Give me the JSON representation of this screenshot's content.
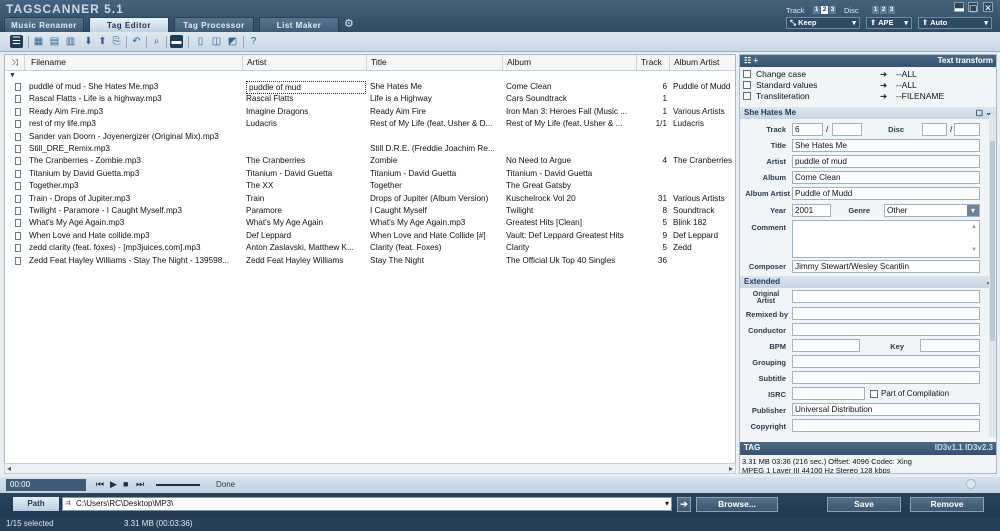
{
  "app": {
    "title": "TAGSCANNER 5.1"
  },
  "tabs": [
    "Music Renamer",
    "Tag Editor",
    "Tag Processor",
    "List Maker"
  ],
  "topright": {
    "track_label": "Track",
    "disc_label": "Disc",
    "keep": "Keep",
    "ape": "APE",
    "auto": "Auto"
  },
  "columns": {
    "filename": "Filename",
    "artist": "Artist",
    "title": "Title",
    "album": "Album",
    "track": "Track",
    "album_artist": "Album Artist"
  },
  "rows": [
    {
      "filename": "puddle of mud - She Hates Me.mp3",
      "artist": "puddle of mud",
      "title": "She Hates Me",
      "album": "Come Clean",
      "track": "6",
      "album_artist": "Puddle of Mudd"
    },
    {
      "filename": "Rascal Flatts - Life is a highway.mp3",
      "artist": "Rascal Flatts",
      "title": "Life is a Highway",
      "album": "Cars Soundtrack",
      "track": "1",
      "album_artist": ""
    },
    {
      "filename": "Ready Aim Fire.mp3",
      "artist": "Imagine Dragons",
      "title": "Ready Aim Fire",
      "album": "Iron Man 3: Heroes Fall (Music ...",
      "track": "1",
      "album_artist": "Various Artists"
    },
    {
      "filename": "rest of my life.mp3",
      "artist": "Ludacris",
      "title": "Rest of My Life (feat. Usher & D...",
      "album": "Rest of My Life (feat. Usher & ...",
      "track": "1/1",
      "album_artist": "Ludacris"
    },
    {
      "filename": "Sander van Doorn - Joyenergizer (Original Mix).mp3",
      "artist": "",
      "title": "",
      "album": "",
      "track": "",
      "album_artist": ""
    },
    {
      "filename": "Still_DRE_Remix.mp3",
      "artist": "",
      "title": "Still D.R.E. (Freddie Joachim Re...",
      "album": "",
      "track": "",
      "album_artist": ""
    },
    {
      "filename": "The Cranberries - Zombie.mp3",
      "artist": "The Cranberries",
      "title": "Zombie",
      "album": "No Need to Argue",
      "track": "4",
      "album_artist": "The Cranberries"
    },
    {
      "filename": "Titanium by David Guetta.mp3",
      "artist": "Titanium - David Guetta",
      "title": "Titanium - David Guetta",
      "album": "Titanium - David Guetta",
      "track": "",
      "album_artist": ""
    },
    {
      "filename": "Together.mp3",
      "artist": "The XX",
      "title": "Together",
      "album": "The Great Gatsby",
      "track": "",
      "album_artist": ""
    },
    {
      "filename": "Train - Drops of Jupiter.mp3",
      "artist": "Train",
      "title": "Drops of Jupiter (Album Version)",
      "album": "Kuschelrock Vol 20",
      "track": "31",
      "album_artist": "Various Artists"
    },
    {
      "filename": "Twilight - Paramore - I Caught Myself.mp3",
      "artist": "Paramore",
      "title": "I Caught Myself",
      "album": "Twilight",
      "track": "8",
      "album_artist": "Soundtrack"
    },
    {
      "filename": "What's My Age Again.mp3",
      "artist": "What's My Age Again",
      "title": "What's My Age Again.mp3",
      "album": "Greatest Hits [Clean]",
      "track": "5",
      "album_artist": "Blink 182"
    },
    {
      "filename": "When Love and Hate collide.mp3",
      "artist": "Def Leppard",
      "title": "When Love and Hate Collide [#]",
      "album": "Vault: Def Leppard Greatest Hits",
      "track": "9",
      "album_artist": "Def Leppard"
    },
    {
      "filename": "zedd clarity (feat. foxes) - [mp3juices.com].mp3",
      "artist": "Anton Zaslavski, Matthew K...",
      "title": "Clarity (feat. Foxes)",
      "album": "Clarity",
      "track": "5",
      "album_artist": "Zedd"
    },
    {
      "filename": "Zedd Feat Hayley Williams - Stay The Night - 139598...",
      "artist": "Zedd Feat Hayley Williams",
      "title": "Stay The Night",
      "album": "The Official Uk Top 40 Singles",
      "track": "36",
      "album_artist": ""
    }
  ],
  "transform": {
    "title": "Text transform",
    "items": [
      {
        "label": "Change case",
        "value": "--ALL"
      },
      {
        "label": "Standard values",
        "value": "--ALL"
      },
      {
        "label": "Transliteration",
        "value": "--FILENAME"
      }
    ]
  },
  "main": {
    "title": "She Hates Me",
    "track_label": "Track",
    "track": "6",
    "slash": "/",
    "disc_label": "Disc",
    "title_label": "Title",
    "artist_label": "Artist",
    "artist": "puddle of mud",
    "album_label": "Album",
    "album": "Come Clean",
    "album_artist_label": "Album Artist",
    "album_artist": "Puddle of Mudd",
    "year_label": "Year",
    "year": "2001",
    "genre_label": "Genre",
    "genre": "Other",
    "comment_label": "Comment",
    "composer_label": "Composer",
    "composer": "Jimmy Stewart/Wesley Scantlin"
  },
  "extended": {
    "title": "Extended",
    "original_artist_label": "Original Artist",
    "remixed_label": "Remixed by",
    "conductor_label": "Conductor",
    "bpm_label": "BPM",
    "key_label": "Key",
    "grouping_label": "Grouping",
    "subtitle_label": "Subtitle",
    "isrc_label": "ISRC",
    "compilation_label": "Part of Compilation",
    "publisher_label": "Publisher",
    "publisher": "Universal Distribution",
    "copyright_label": "Copyright"
  },
  "tag": {
    "title": "TAG",
    "versions": "ID3v1.1  ID3v2.3",
    "line1": "3.31 MB 03:36 (216 sec.)  Offset: 4096  Codec: Xing",
    "line2": "MPEG 1 Layer III  44100 Hz  Stereo  128 kbps"
  },
  "player": {
    "time": "00:00",
    "status": "Done"
  },
  "path": {
    "label": "Path",
    "value": "C:\\Users\\RC\\Desktop\\MP3\\"
  },
  "buttons": {
    "browse": "Browse...",
    "save": "Save",
    "remove": "Remove"
  },
  "status": {
    "selected": "1/15 selected",
    "size": "3.31 MB (00:03:36)"
  }
}
